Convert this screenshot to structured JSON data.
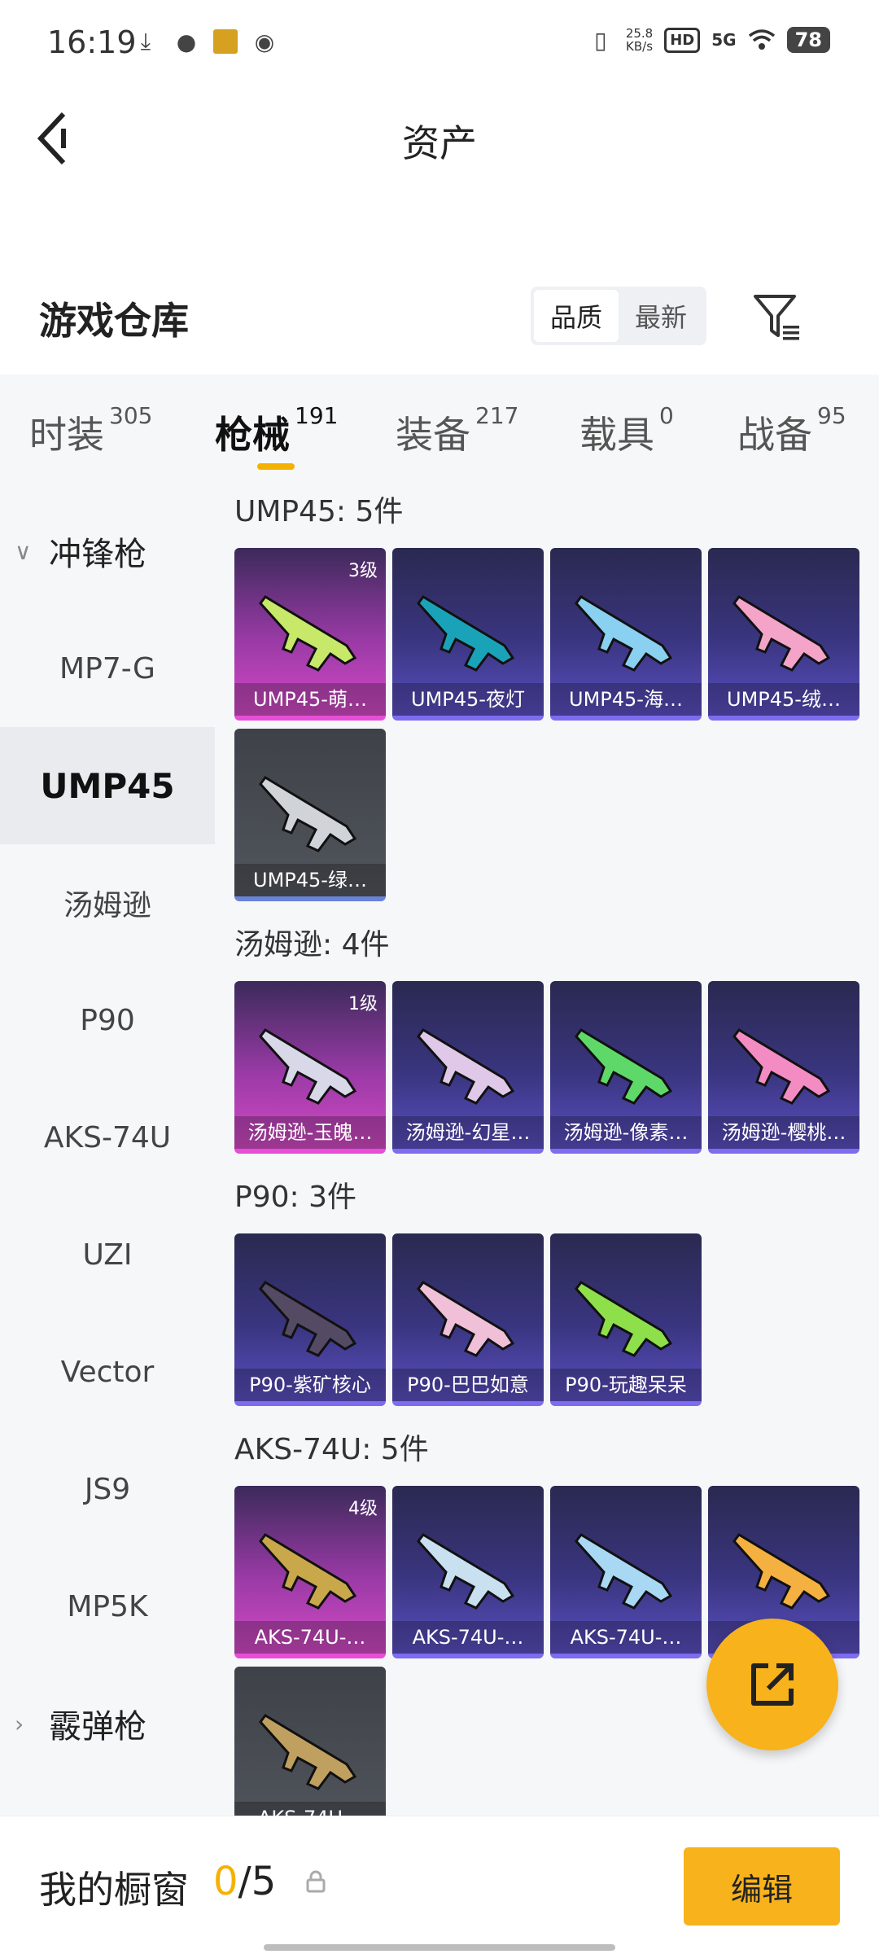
{
  "status_bar": {
    "time": "16:19",
    "speed_value": "25.8",
    "speed_unit": "KB/s",
    "hd": "HD",
    "network": "5G",
    "battery": "78"
  },
  "header": {
    "title": "资产"
  },
  "warehouse": {
    "title": "游戏仓库",
    "sort_options": [
      "品质",
      "最新"
    ],
    "sort_active": "品质"
  },
  "tabs": [
    {
      "label": "时装",
      "count": "305"
    },
    {
      "label": "枪械",
      "count": "191"
    },
    {
      "label": "装备",
      "count": "217"
    },
    {
      "label": "载具",
      "count": "0"
    },
    {
      "label": "战备",
      "count": "95"
    }
  ],
  "sidebar": {
    "group_open": "冲锋枪",
    "items": [
      "MP7-G",
      "UMP45",
      "汤姆逊",
      "P90",
      "AKS-74U",
      "UZI",
      "Vector",
      "JS9",
      "MP5K"
    ],
    "group_closed": "霰弹枪"
  },
  "sections": [
    {
      "title": "UMP45: 5件",
      "items": [
        {
          "label": "UMP45-萌…",
          "level": "3级",
          "rarity": "pink",
          "gun_color": "#c8e86a"
        },
        {
          "label": "UMP45-夜灯",
          "level": "",
          "rarity": "purple",
          "gun_color": "#1aa3b8"
        },
        {
          "label": "UMP45-海…",
          "level": "",
          "rarity": "purple",
          "gun_color": "#8ad0f0"
        },
        {
          "label": "UMP45-绒…",
          "level": "",
          "rarity": "purple",
          "gun_color": "#f3a4c8"
        },
        {
          "label": "UMP45-绿…",
          "level": "",
          "rarity": "gray",
          "gun_color": "#d0d4d8"
        }
      ]
    },
    {
      "title": "汤姆逊: 4件",
      "items": [
        {
          "label": "汤姆逊-玉魄…",
          "level": "1级",
          "rarity": "pink",
          "gun_color": "#d8d8e8"
        },
        {
          "label": "汤姆逊-幻星…",
          "level": "",
          "rarity": "purple",
          "gun_color": "#e0c8e8"
        },
        {
          "label": "汤姆逊-像素…",
          "level": "",
          "rarity": "purple",
          "gun_color": "#5fd86a"
        },
        {
          "label": "汤姆逊-樱桃…",
          "level": "",
          "rarity": "purple",
          "gun_color": "#f48cc4"
        }
      ]
    },
    {
      "title": "P90: 3件",
      "items": [
        {
          "label": "P90-紫矿核心",
          "level": "",
          "rarity": "purple",
          "gun_color": "#554a64"
        },
        {
          "label": "P90-巴巴如意",
          "level": "",
          "rarity": "purple",
          "gun_color": "#f0c0d8"
        },
        {
          "label": "P90-玩趣呆呆",
          "level": "",
          "rarity": "purple",
          "gun_color": "#8ee04a"
        }
      ]
    },
    {
      "title": "AKS-74U: 5件",
      "items": [
        {
          "label": "AKS-74U-…",
          "level": "4级",
          "rarity": "pink",
          "gun_color": "#c8a84a"
        },
        {
          "label": "AKS-74U-…",
          "level": "",
          "rarity": "purple",
          "gun_color": "#c8e0f0"
        },
        {
          "label": "AKS-74U-…",
          "level": "",
          "rarity": "purple",
          "gun_color": "#a8d8f4"
        },
        {
          "label": "",
          "level": "",
          "rarity": "purple",
          "gun_color": "#f4b040"
        },
        {
          "label": "AKS-74U…",
          "level": "",
          "rarity": "gray",
          "gun_color": "#c0a060"
        }
      ]
    }
  ],
  "showcase": {
    "title": "我的橱窗",
    "used": "0",
    "total": "/5",
    "edit_label": "编辑"
  },
  "colors": {
    "accent": "#f7b21c",
    "highlight": "#f5b100"
  }
}
